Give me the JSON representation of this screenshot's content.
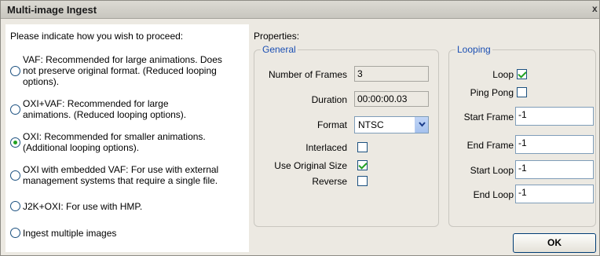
{
  "window": {
    "title": "Multi-image Ingest",
    "close_label": "x"
  },
  "left": {
    "prompt": "Please indicate how you wish to proceed:",
    "options": [
      {
        "lines": [
          "VAF: Recommended for large animations. Does",
          "not preserve original format. (Reduced looping",
          "options)."
        ],
        "checked": false
      },
      {
        "lines": [
          "OXI+VAF: Recommended for large",
          "animations. (Reduced looping options)."
        ],
        "checked": false
      },
      {
        "lines": [
          "OXI: Recommended for smaller animations.",
          "(Additional looping options)."
        ],
        "checked": true
      },
      {
        "lines": [
          "OXI with embedded VAF: For use with external",
          "management systems that require a single file."
        ],
        "checked": false
      },
      {
        "lines": [
          "J2K+OXI: For use with HMP."
        ],
        "checked": false
      },
      {
        "lines": [
          "Ingest multiple images"
        ],
        "checked": false
      }
    ]
  },
  "properties": {
    "label": "Properties:",
    "general": {
      "title": "General",
      "num_frames_label": "Number of Frames",
      "num_frames_value": "3",
      "duration_label": "Duration",
      "duration_value": "00:00:00.03",
      "format_label": "Format",
      "format_value": "NTSC",
      "interlaced_label": "Interlaced",
      "interlaced_checked": false,
      "use_original_label": "Use Original Size",
      "use_original_checked": true,
      "reverse_label": "Reverse",
      "reverse_checked": false
    },
    "looping": {
      "title": "Looping",
      "loop_label": "Loop",
      "loop_checked": true,
      "pingpong_label": "Ping Pong",
      "pingpong_checked": false,
      "start_frame_label": "Start Frame",
      "start_frame_value": "-1",
      "end_frame_label": "End Frame",
      "end_frame_value": "-1",
      "start_loop_label": "Start Loop",
      "start_loop_value": "-1",
      "end_loop_label": "End Loop",
      "end_loop_value": "-1"
    }
  },
  "ok_label": "OK",
  "colors": {
    "group_title": "#1b4fb3",
    "check_green": "#21a121",
    "dialog_bg": "#ece9e2"
  }
}
